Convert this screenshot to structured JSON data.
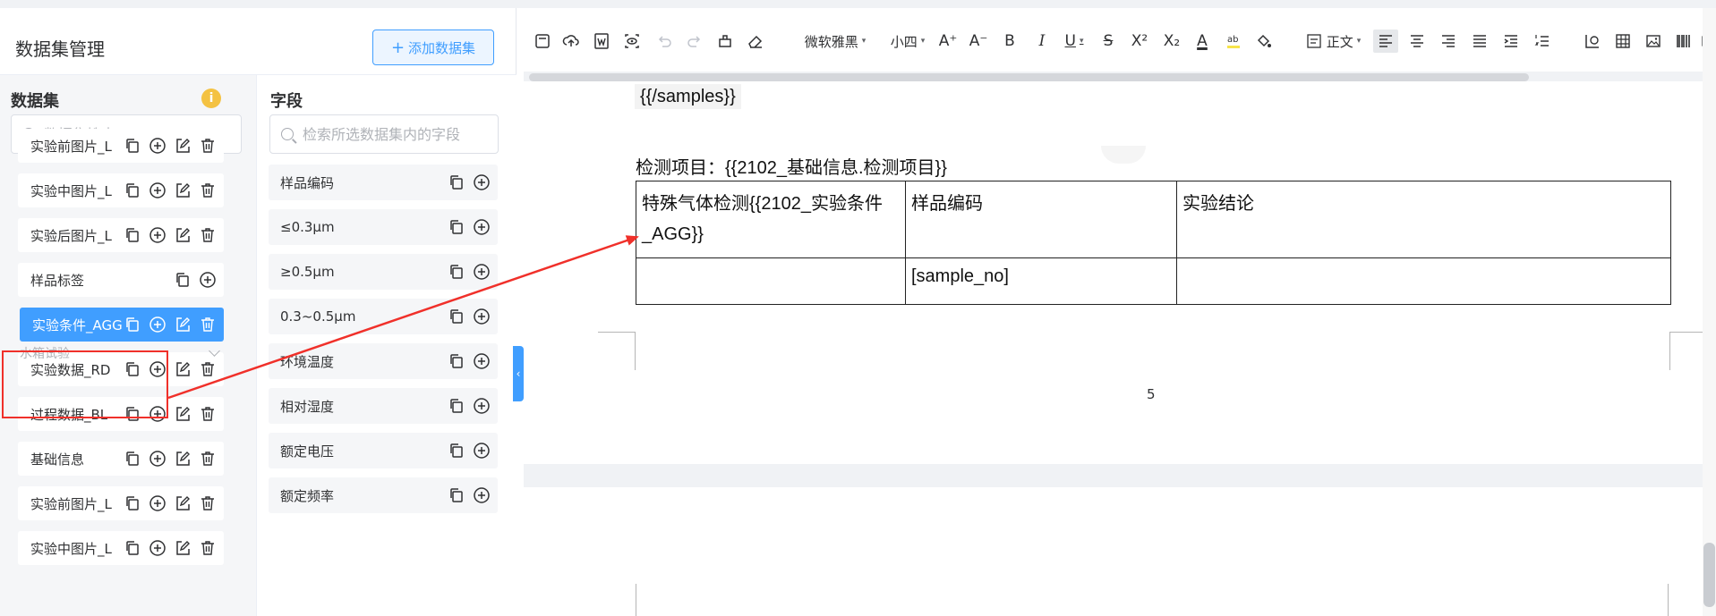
{
  "panel": {
    "title": "数据集管理",
    "add_button": "添加数据集"
  },
  "datasets": {
    "title": "数据集",
    "search_placeholder": "数据集搜索",
    "items_top": [
      {
        "label": "实验前图片_L"
      },
      {
        "label": "实验中图片_L"
      },
      {
        "label": "实验后图片_L"
      },
      {
        "label": "样品标签"
      }
    ],
    "group": "水箱试验",
    "items_group": [
      {
        "label": "实验条件_AGG"
      },
      {
        "label": "实验数据_RD"
      },
      {
        "label": "过程数据_BL"
      },
      {
        "label": "基础信息"
      },
      {
        "label": "实验前图片_L"
      },
      {
        "label": "实验中图片_L"
      }
    ]
  },
  "fields": {
    "title": "字段",
    "search_placeholder": "检索所选数据集内的字段",
    "items": [
      {
        "label": "样品编码"
      },
      {
        "label": "≤0.3μm"
      },
      {
        "label": "≥0.5μm"
      },
      {
        "label": "0.3~0.5μm"
      },
      {
        "label": "环境温度"
      },
      {
        "label": "相对湿度"
      },
      {
        "label": "额定电压"
      },
      {
        "label": "额定频率"
      }
    ]
  },
  "toolbar": {
    "font_family": "微软雅黑",
    "font_size": "小四",
    "paragraph_style": "正文",
    "bold": "B",
    "italic": "I",
    "underline": "U",
    "strike": "S",
    "superscript": "X²",
    "subscript": "X₂",
    "font_color": "A",
    "increase_font": "A⁺",
    "decrease_font": "A⁻"
  },
  "document": {
    "samples_end_tag": "{{/samples}}",
    "project_line": "检测项目：{{2102_基础信息.检测项目}}",
    "table": {
      "header": [
        "特殊气体检测{{2102_实验条件_AGG}}",
        "样品编码",
        "实验结论"
      ],
      "row": [
        "",
        "[sample_no]",
        ""
      ]
    },
    "page_number": "5"
  },
  "colors": {
    "primary": "#409eff",
    "annotation_red": "#f0302a",
    "info_yellow": "#f4c242"
  }
}
